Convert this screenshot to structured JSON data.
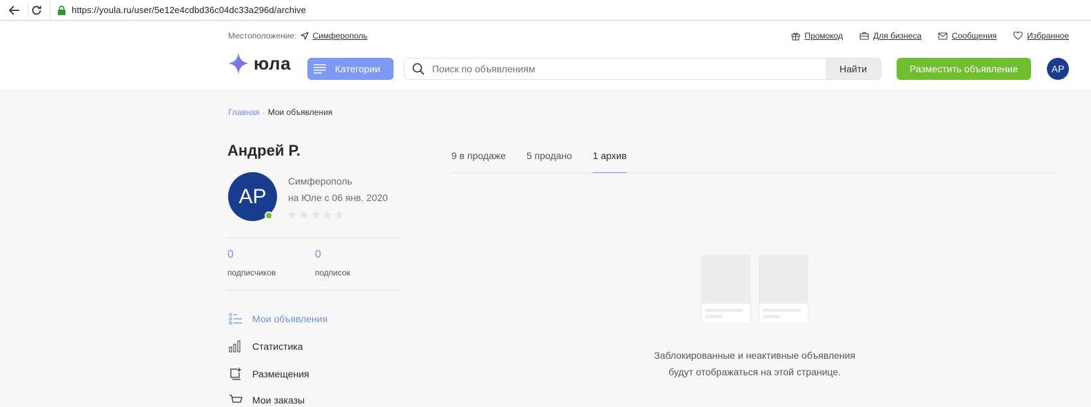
{
  "browser": {
    "url": "https://youla.ru/user/5e12e4cdbd36c04dc33a296d/archive"
  },
  "header": {
    "location_label": "Местоположение:",
    "location_city": "Симферополь",
    "links": {
      "promo": "Промокод",
      "business": "Для бизнеса",
      "messages": "Сообщения",
      "favorites": "Избранное"
    },
    "logo_text": "юла",
    "categories_label": "Категории",
    "search_placeholder": "Поиск по объявлениям",
    "search_button": "Найти",
    "post_button": "Разместить объявление",
    "user_initials": "АР"
  },
  "breadcrumb": {
    "home": "Главная",
    "separator": "·",
    "current": "Мои объявления"
  },
  "profile": {
    "name": "Андрей Р.",
    "initials": "АР",
    "city": "Симферополь",
    "since": "на Юле с  06 янв. 2020",
    "rating_stars": 0,
    "subscribers_count": "0",
    "subscribers_label": "подписчиков",
    "subscriptions_count": "0",
    "subscriptions_label": "подписок"
  },
  "sidebar": {
    "items": [
      {
        "label": "Мои объявления",
        "icon": "list-icon",
        "active": true
      },
      {
        "label": "Статистика",
        "icon": "bar-chart-icon",
        "active": false
      },
      {
        "label": "Размещения",
        "icon": "placement-icon",
        "active": false
      },
      {
        "label": "Мои заказы",
        "icon": "cart-icon",
        "active": false
      }
    ]
  },
  "tabs": [
    {
      "label": "9 в продаже",
      "active": false
    },
    {
      "label": "5 продано",
      "active": false
    },
    {
      "label": "1 архив",
      "active": true
    }
  ],
  "empty_state": {
    "text": "Заблокированные и неактивные объявления будут отображаться на этой странице."
  },
  "colors": {
    "accent": "#7e98f5",
    "link": "#7091e0",
    "green": "#6fbe2e",
    "avatar": "#183c8e"
  }
}
